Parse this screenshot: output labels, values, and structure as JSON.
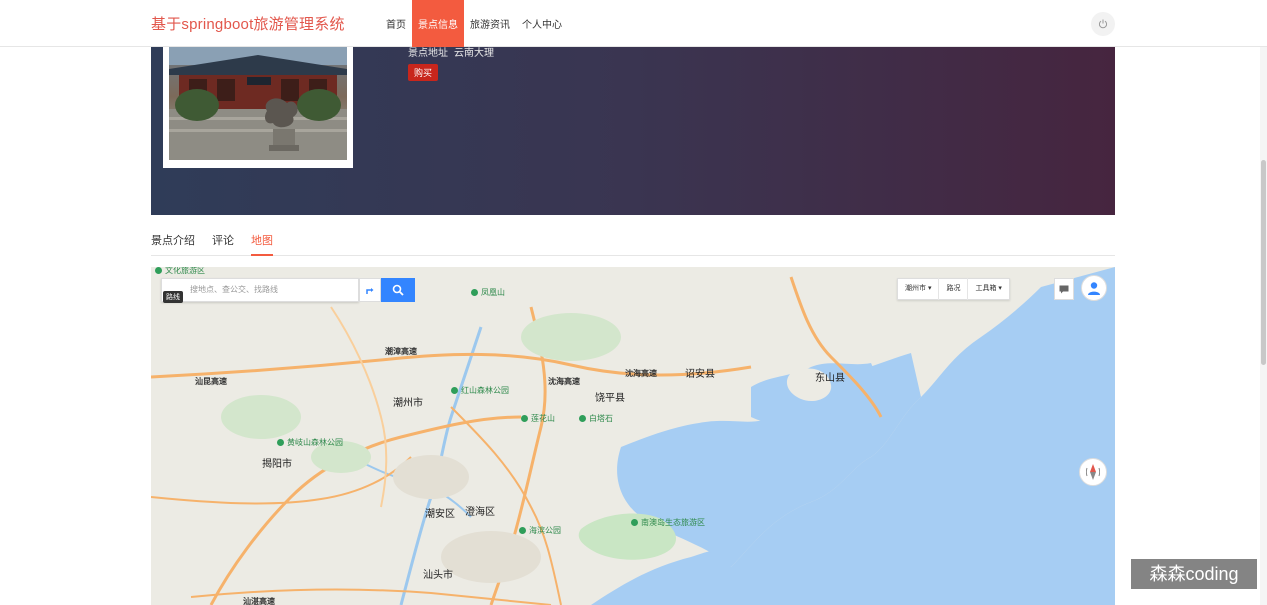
{
  "header": {
    "brand": "基于springboot旅游管理系统",
    "nav": [
      {
        "label": "首页",
        "active": false
      },
      {
        "label": "景点信息",
        "active": true
      },
      {
        "label": "旅游资讯",
        "active": false
      },
      {
        "label": "个人中心",
        "active": false
      }
    ],
    "power_icon": "power-icon"
  },
  "hero": {
    "address_label": "景点地址",
    "address_value": "云南大理",
    "buy_label": "购买"
  },
  "tabs": [
    {
      "label": "景点介绍",
      "active": false
    },
    {
      "label": "评论",
      "active": false
    },
    {
      "label": "地图",
      "active": true
    }
  ],
  "map": {
    "search_placeholder": "搜地点、查公交、找路线",
    "layer_tag": "路线",
    "toolbar": {
      "city": "潮州市",
      "traffic": "路况",
      "tools": "工具箱"
    },
    "labels": {
      "chaozhou": "潮州市",
      "jieyang": "揭阳市",
      "shantou": "汕头市",
      "raoping": "饶平县",
      "zhaoan": "诏安县",
      "dongshan": "东山县",
      "chaoan": "潮安区",
      "chenghai": "澄海区",
      "chaoshan_hwy": "潮漳高速",
      "shenhai_hwy1": "沈海高速",
      "shenhai_hwy2": "沈海高速",
      "shantan_hwy": "汕昆高速",
      "lianghu": "汕湛高速"
    },
    "pois": {
      "p1": "文化旅游区",
      "p2": "凤凰山",
      "p3": "红山森林公园",
      "p4": "黄岐山森林公园",
      "p5": "莲花山",
      "p6": "白塔石",
      "p7": "南澳岛生态旅游区",
      "p8": "海滨公园"
    }
  },
  "watermark": "森森coding",
  "colors": {
    "accent": "#f35b3f",
    "brand": "#e2574c",
    "buy": "#c8261c",
    "map_search": "#3385ff",
    "sea": "#a6cdf3"
  }
}
